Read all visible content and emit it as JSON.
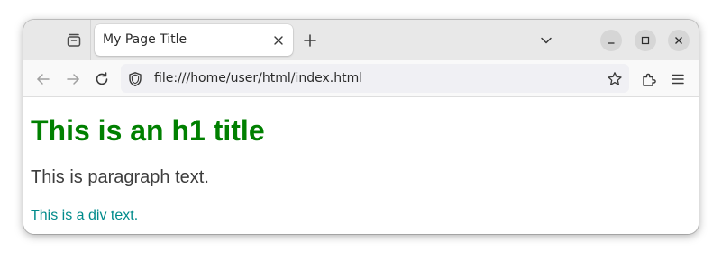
{
  "tab": {
    "title": "My Page Title"
  },
  "navigation": {
    "url": "file:///home/user/html/index.html"
  },
  "page": {
    "heading": "This is an h1 title",
    "paragraph": "This is paragraph text.",
    "div_text": "This is a div text."
  },
  "colors": {
    "heading": "#008000",
    "paragraph": "#3d3d3d",
    "div_text": "#008b8b",
    "tabbar": "#e8e8e8",
    "urlbar": "#f0f0f4"
  },
  "icons": {
    "tabs_list": "tab-list-icon",
    "tab_close": "close-icon",
    "new_tab": "plus-icon",
    "list_all_tabs": "chevron-down-icon",
    "minimize": "minimize-icon",
    "maximize": "maximize-icon",
    "window_close": "close-icon",
    "back": "arrow-left-icon",
    "forward": "arrow-right-icon",
    "reload": "reload-icon",
    "site_info": "shield-icon",
    "bookmark": "star-icon",
    "extensions": "puzzle-icon",
    "menu": "hamburger-menu-icon"
  }
}
